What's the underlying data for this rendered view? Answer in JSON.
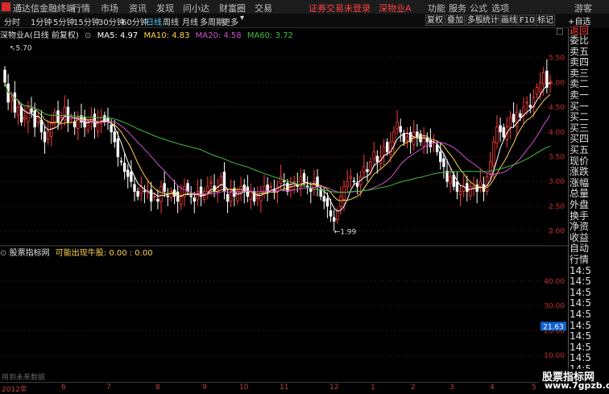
{
  "titlebar": {
    "app_name": "通达信金融终端",
    "menu": [
      "行情",
      "市场",
      "资讯",
      "发现",
      "问小达",
      "财富圈",
      "交易"
    ],
    "status": "证券交易未登录",
    "stock": "深物业A",
    "right_menu": [
      "功能",
      "服务",
      "公式",
      "选项"
    ],
    "user": "游客"
  },
  "toolbar": {
    "periods": [
      "分时",
      "1分钟",
      "5分钟",
      "15分钟",
      "30分钟",
      "60分钟",
      "日线",
      "周线",
      "月线",
      "多周期",
      "更多"
    ],
    "active_period": "日线",
    "buttons": [
      "复权",
      "叠加",
      "多股",
      "统计",
      "画线",
      "F10",
      "标记"
    ]
  },
  "info": {
    "title": "深物业A(日线 前复权)",
    "ma5": "MA5: 4.97",
    "ma10": "MA10: 4.83",
    "ma20": "MA20: 4.58",
    "ma60": "MA60: 3.72"
  },
  "colors": {
    "up": "#ff3c3c",
    "down": "#ffffff",
    "ma5": "#ffffff",
    "ma10": "#ffd24d",
    "ma20": "#d050d0",
    "ma60": "#40c040",
    "axis": "#c03030",
    "active": "#55ccff"
  },
  "chart_data": {
    "type": "candlestick",
    "price_ticks": [
      "5.50",
      "5.00",
      "4.50",
      "4.00",
      "3.50",
      "3.00",
      "2.50",
      "2.00"
    ],
    "ylim": [
      1.8,
      5.9
    ],
    "high_mark": "5.70",
    "low_mark": "1.99",
    "closes": [
      5.0,
      4.6,
      4.7,
      4.4,
      4.5,
      4.2,
      4.3,
      4.5,
      4.4,
      4.1,
      4.3,
      4.0,
      3.8,
      4.0,
      4.2,
      4.4,
      4.2,
      4.3,
      4.5,
      4.2,
      4.3,
      4.1,
      4.3,
      4.2,
      4.1,
      4.2,
      4.3,
      4.1,
      4.2,
      4.3,
      4.2,
      4.2,
      4.0,
      3.8,
      3.5,
      3.4,
      3.2,
      3.1,
      3.0,
      2.8,
      2.7,
      2.9,
      2.8,
      2.8,
      2.6,
      2.7,
      2.6,
      2.9,
      2.8,
      2.7,
      2.8,
      2.7,
      2.6,
      2.7,
      2.9,
      2.8,
      2.7,
      2.6,
      2.8,
      2.7,
      2.8,
      2.9,
      3.0,
      2.8,
      2.9,
      3.1,
      2.8,
      2.6,
      2.8,
      2.7,
      2.8,
      2.9,
      2.8,
      2.7,
      2.8,
      2.6,
      2.7,
      2.8,
      2.9,
      2.8,
      2.9,
      2.8,
      2.9,
      3.1,
      3.0,
      2.8,
      2.9,
      3.0,
      2.9,
      3.1,
      3.0,
      2.9,
      2.8,
      3.0,
      2.9,
      2.7,
      2.6,
      2.5,
      2.3,
      2.2,
      2.4,
      2.7,
      2.9,
      3.0,
      3.1,
      3.0,
      2.9,
      3.1,
      3.3,
      3.2,
      3.4,
      3.6,
      3.4,
      3.5,
      3.7,
      3.6,
      3.8,
      4.0,
      4.2,
      4.0,
      3.8,
      3.9,
      3.8,
      4.0,
      3.9,
      3.8,
      3.9,
      3.8,
      3.7,
      3.8,
      3.6,
      3.4,
      3.3,
      3.0,
      3.1,
      2.9,
      2.8,
      2.8,
      2.9,
      2.8,
      2.9,
      2.9,
      2.8,
      3.0,
      2.8,
      3.1,
      3.4,
      3.8,
      4.1,
      4.0,
      3.9,
      4.1,
      4.3,
      4.2,
      4.4,
      4.3,
      4.5,
      4.6,
      4.5,
      4.7,
      4.9,
      5.0,
      5.2,
      4.9,
      5.0
    ],
    "indicator": {
      "name": "股票指标网",
      "label": "可能出现牛股: 0.00 : 0.00",
      "ticks": [
        "40.00",
        "30.00",
        "20.00",
        "10.00"
      ],
      "ylim": [
        0,
        50
      ],
      "marker": "21.63"
    },
    "x_labels": [
      "2012年",
      "6",
      "7",
      "8",
      "9",
      "10",
      "11",
      "12",
      "1",
      "2",
      "3",
      "4",
      "5"
    ]
  },
  "right_panel": {
    "labels": [
      "委比",
      "卖五",
      "卖四",
      "卖三",
      "卖二",
      "卖一",
      "买一",
      "买二",
      "买三",
      "买四",
      "买五",
      "现价",
      "涨跌",
      "涨幅",
      "总量",
      "外盘",
      "换手",
      "净资",
      "收益",
      "自动",
      "行情",
      "14:5",
      "14:5",
      "14:5",
      "14:5",
      "14:5",
      "14:5",
      "14:5",
      "14:5",
      "14:5",
      "14:5",
      "14:5"
    ]
  },
  "right_top": {
    "tab": "+自选",
    "back": "返回",
    "letter": "L"
  },
  "watermark": {
    "line1": "股票指标网",
    "line2": "www.7gpzb.com"
  },
  "footer_note": "用到未来数据"
}
